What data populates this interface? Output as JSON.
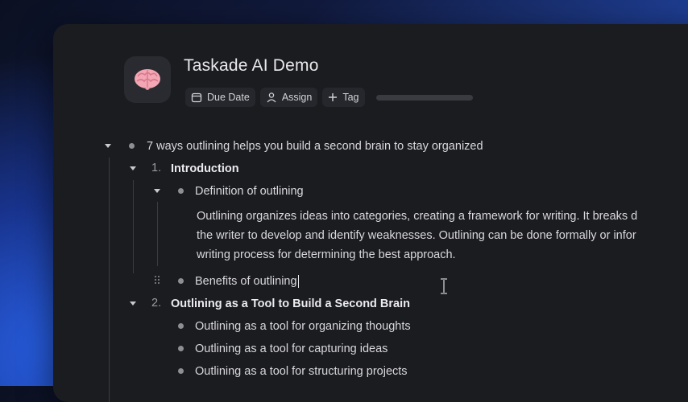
{
  "project": {
    "title": "Taskade AI Demo",
    "icon": "brain-emoji"
  },
  "meta": {
    "due_date_label": "Due Date",
    "assign_label": "Assign",
    "tag_label": "Tag",
    "progress": 0
  },
  "outline": {
    "root": "7 ways outlining helps you build a second brain to stay organized",
    "item1": {
      "number": "1.",
      "label": "Introduction"
    },
    "item1_1": "Definition of outlining",
    "paragraph": [
      "Outlining organizes ideas into categories, creating a framework for writing. It breaks d",
      "the writer to develop and identify weaknesses. Outlining can be done formally or infor",
      "writing process for determining the best approach."
    ],
    "item1_2": "Benefits of outlining",
    "item2": {
      "number": "2.",
      "label": "Outlining as a Tool to Build a Second Brain"
    },
    "item2_children": [
      "Outlining as a tool for organizing thoughts",
      "Outlining as a tool for capturing ideas",
      "Outlining as a tool for structuring projects"
    ]
  },
  "colors": {
    "window_bg": "#1b1c20",
    "text": "#d9d9dd",
    "accent_blue": "#2457d6"
  }
}
